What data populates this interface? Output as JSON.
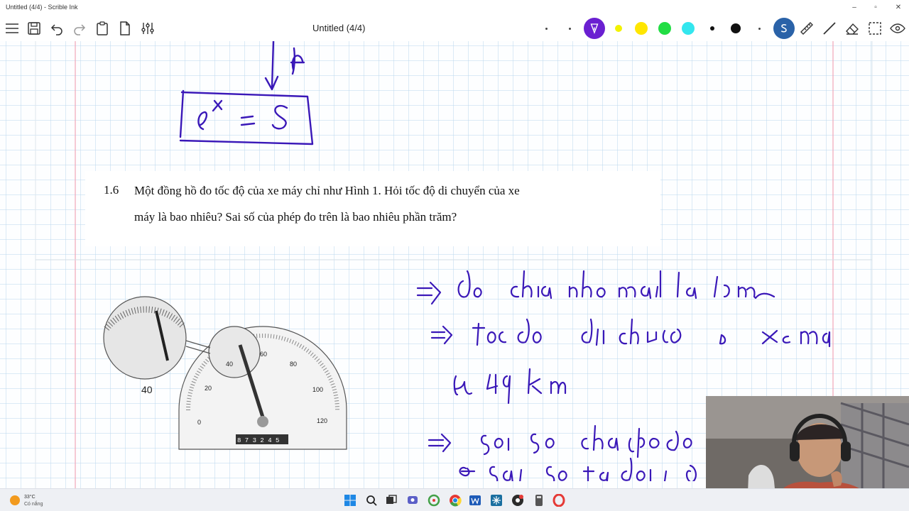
{
  "window": {
    "app_title": "Untitled (4/4) - Scrible Ink",
    "minimize": "–",
    "maximize": "▫",
    "close": "✕"
  },
  "toolbar": {
    "doc_title": "Untitled (4/4)",
    "icons": [
      "menu-icon",
      "save-icon",
      "undo-icon",
      "redo-icon",
      "clipboard-icon",
      "new-page-icon",
      "settings-sliders-icon"
    ],
    "pen_colors": [
      "#6a1fd1",
      "#f2f200",
      "#ffe600",
      "#22dd44",
      "#33e6ee",
      "#111111"
    ],
    "active_color": "#3a76c4"
  },
  "problem": {
    "number": "1.6",
    "line1": "Một đồng hồ đo tốc độ của xe máy chỉ như Hình 1. Hỏi tốc độ di chuyển của xe",
    "line2": "máy là bao nhiêu? Sai số của phép đo trên là bao nhiêu phần trăm?"
  },
  "speedometer": {
    "ticks": [
      "0",
      "20",
      "40",
      "60",
      "80",
      "100",
      "120"
    ],
    "zoom_label": "40",
    "odometer": "8 7 3 2 4 5"
  },
  "taskbar": {
    "temperature": "33°C",
    "condition": "Có nắng"
  },
  "ink_color": "#3a18b8"
}
